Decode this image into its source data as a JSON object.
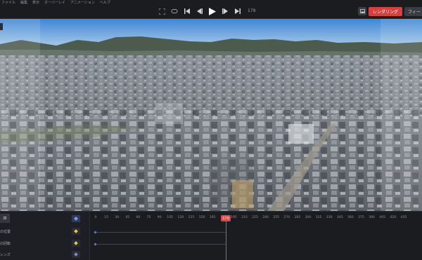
{
  "menu": [
    "ファイル",
    "編集",
    "表示",
    "オーバーレイ",
    "アニメーション",
    "ヘルプ"
  ],
  "transport": {
    "frame": "179",
    "buttons": [
      "fit-icon",
      "loop-icon",
      "skip-start-icon",
      "step-back-icon",
      "play-icon",
      "step-forward-icon",
      "skip-end-icon"
    ]
  },
  "actions": {
    "render_label": "レンダリング",
    "feature_label": "フィー",
    "render_color": "#d6403f"
  },
  "timeline": {
    "header_label": "四",
    "tracks": [
      {
        "label": "の位置",
        "key_color": "#e9c94a"
      },
      {
        "label": "の回転",
        "key_color": "#e9c94a"
      },
      {
        "label": "レンズ",
        "key_color": "#7b8bd6"
      }
    ],
    "ruler_ticks": [
      "0",
      "15",
      "30",
      "45",
      "60",
      "75",
      "90",
      "105",
      "120",
      "135",
      "150",
      "165",
      "179",
      "195",
      "210",
      "225",
      "240",
      "255",
      "270",
      "285",
      "300",
      "315",
      "330",
      "345",
      "360",
      "375",
      "390",
      "405",
      "420",
      "435"
    ],
    "playhead_frame": "179",
    "playhead_color": "#e04848"
  }
}
